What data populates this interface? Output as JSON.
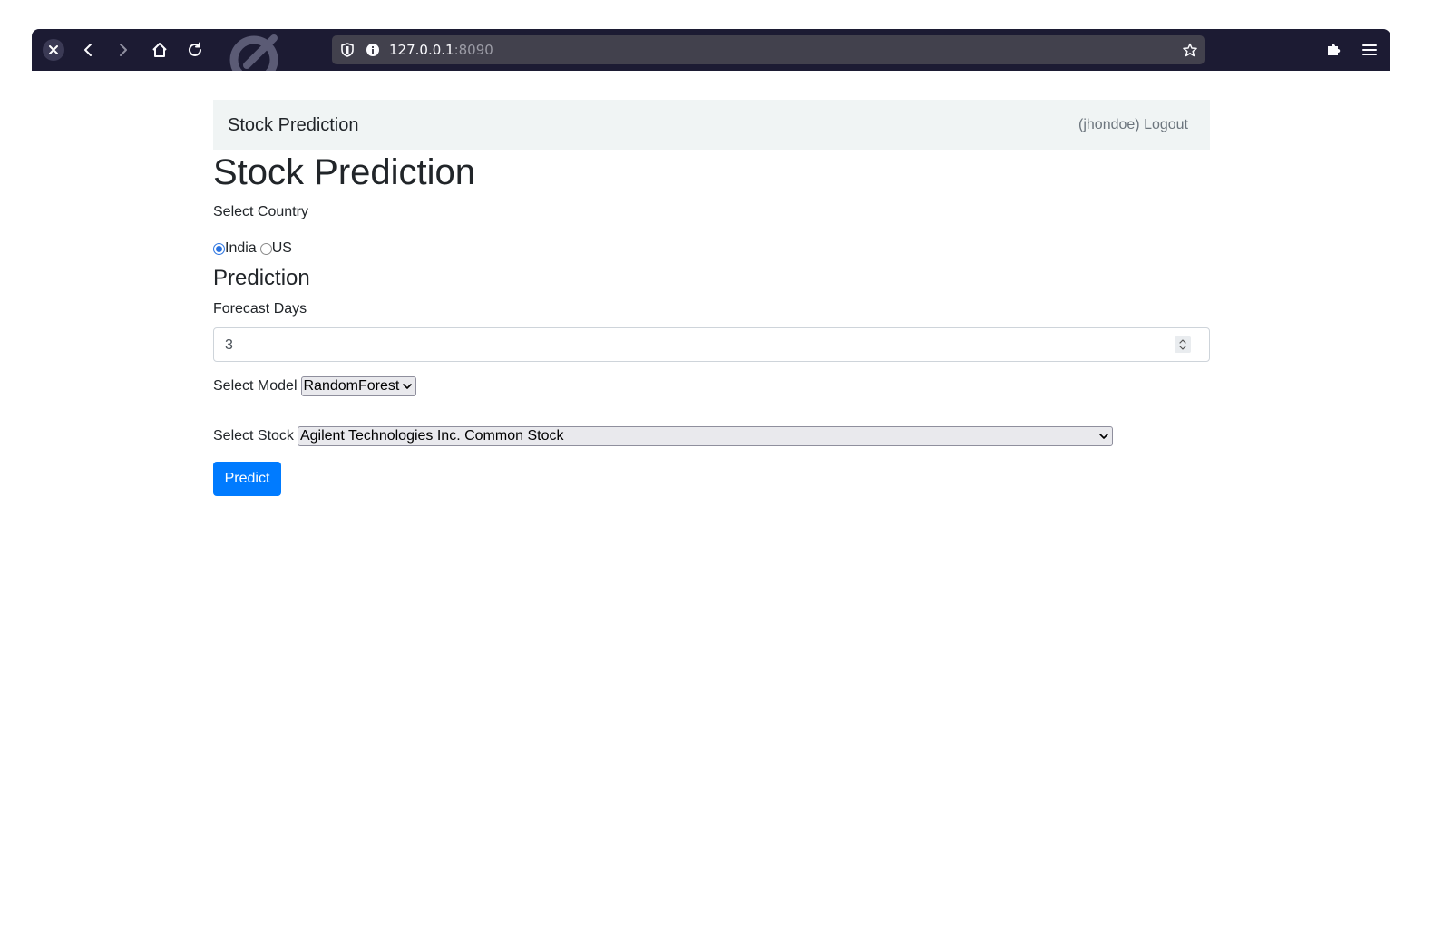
{
  "browser": {
    "url_host": "127.0.0.1",
    "url_port": ":8090"
  },
  "navbar": {
    "brand": "Stock Prediction",
    "user_link": "(jhondoe) Logout"
  },
  "page": {
    "title": "Stock Prediction",
    "country_label": "Select Country",
    "countries": [
      {
        "label": "India",
        "checked": true
      },
      {
        "label": "US",
        "checked": false
      }
    ],
    "prediction_heading": "Prediction",
    "forecast_label": "Forecast Days",
    "forecast_value": "3",
    "model_label": "Select Model",
    "model_selected": "RandomForest",
    "stock_label": "Select Stock",
    "stock_selected": "Agilent Technologies Inc. Common Stock",
    "predict_button": "Predict"
  },
  "colors": {
    "primary": "#007bff",
    "browser_bar": "#1c1b33",
    "navbar_bg": "#f0f4f4"
  }
}
